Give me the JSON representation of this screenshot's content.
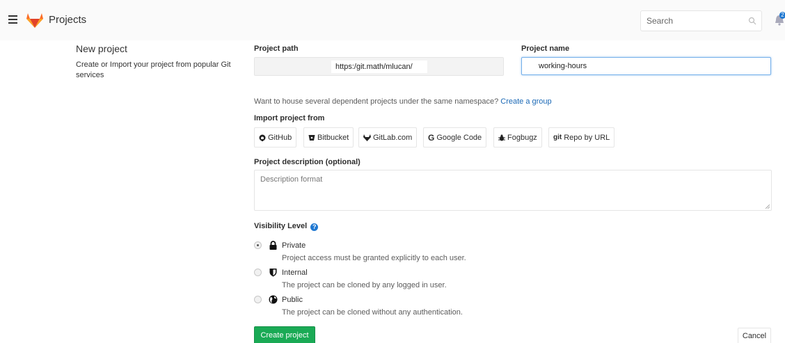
{
  "header": {
    "title": "Projects",
    "search_placeholder": "Search",
    "notification_count": "2"
  },
  "intro": {
    "title": "New project",
    "description": "Create or Import your project from popular Git services"
  },
  "form": {
    "path_label": "Project path",
    "path_prefix": "https:/git.math/mlucan/",
    "name_label": "Project name",
    "name_value": "working-hours",
    "namespace_text": "Want to house several dependent projects under the same namespace?",
    "create_group_link": "Create a group",
    "import_label": "Import project from",
    "import_sources": [
      {
        "label": "GitHub",
        "icon": "github-icon"
      },
      {
        "label": "Bitbucket",
        "icon": "bitbucket-icon"
      },
      {
        "label": "GitLab.com",
        "icon": "gitlab-icon"
      },
      {
        "label": "Google Code",
        "icon": "google-icon"
      },
      {
        "label": "Fogbugz",
        "icon": "bug-icon"
      },
      {
        "label": "Repo by URL",
        "icon": "git-icon"
      }
    ],
    "description_label": "Project description (optional)",
    "description_placeholder": "Description format",
    "visibility_label": "Visibility Level",
    "visibility_options": [
      {
        "label": "Private",
        "description": "Project access must be granted explicitly to each user.",
        "icon": "lock-icon",
        "checked": true
      },
      {
        "label": "Internal",
        "description": "The project can be cloned by any logged in user.",
        "icon": "shield-icon",
        "checked": false
      },
      {
        "label": "Public",
        "description": "The project can be cloned without any authentication.",
        "icon": "globe-icon",
        "checked": false
      }
    ],
    "create_button": "Create project",
    "cancel_button": "Cancel"
  },
  "colors": {
    "primary_green": "#1aaa55",
    "link_blue": "#1b69b6",
    "gitlab_orange": "#fc6d26"
  }
}
